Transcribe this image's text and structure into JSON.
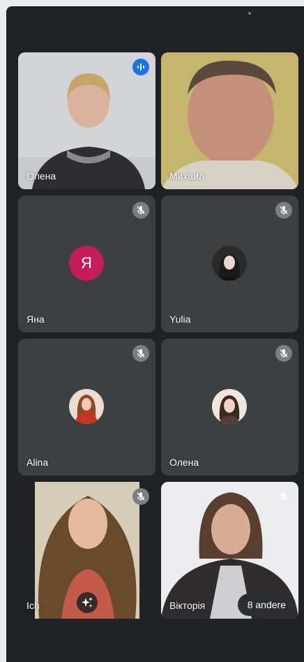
{
  "colors": {
    "background": "#202124",
    "tile": "#3c4043",
    "muted_badge": "#7b7e83",
    "speaking_badge": "#1a73e8",
    "letter_avatar": "#c51d5b"
  },
  "participants": [
    {
      "name": "Олена",
      "muted": false,
      "speaking": true,
      "display": "video"
    },
    {
      "name": "Михаил",
      "muted": false,
      "speaking": false,
      "display": "video"
    },
    {
      "name": "Яна",
      "muted": true,
      "display": "letter-avatar",
      "initial": "Я"
    },
    {
      "name": "Yulia",
      "muted": true,
      "display": "photo-avatar"
    },
    {
      "name": "Alina",
      "muted": true,
      "display": "photo-avatar"
    },
    {
      "name": "Олена",
      "muted": true,
      "display": "photo-avatar"
    },
    {
      "name": "Ich",
      "muted": true,
      "display": "video",
      "effects_icon": "sparkle-icon"
    },
    {
      "name": "Вікторія",
      "muted": true,
      "display": "video"
    }
  ],
  "overflow": {
    "label": "8 andere"
  }
}
